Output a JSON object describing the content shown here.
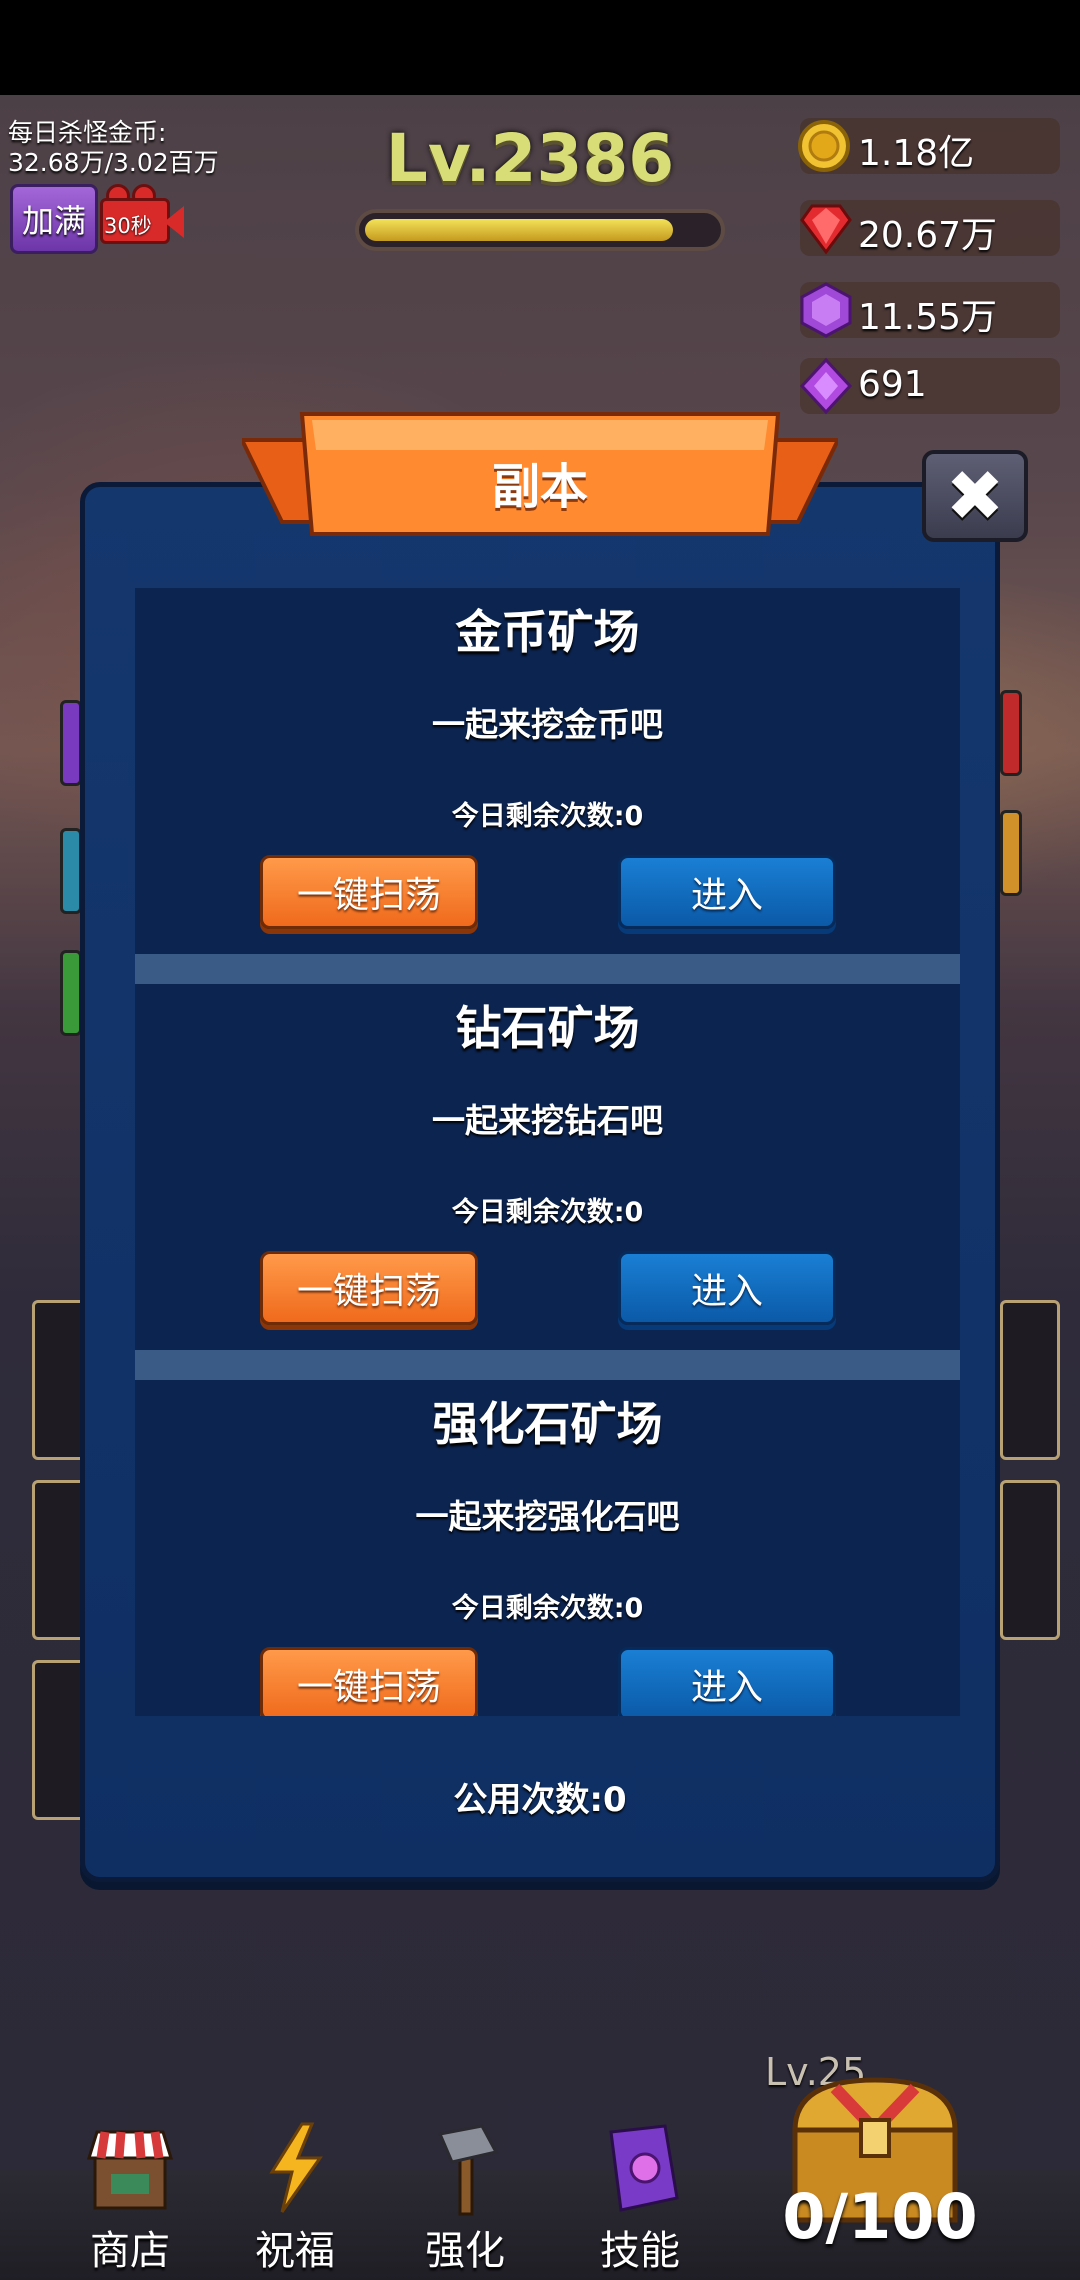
{
  "hud": {
    "kill_gold_label": "每日杀怪金币:",
    "kill_gold_value": "32.68万/3.02百万",
    "fill_button": "加满",
    "video_timer": "30秒",
    "level": "Lv.2386",
    "level_progress": 0.88
  },
  "resources": [
    {
      "name": "gold",
      "icon": "gold-coin-icon",
      "value": "1.18亿",
      "color": "#e8b820"
    },
    {
      "name": "ruby",
      "icon": "ruby-icon",
      "value": "20.67万",
      "color": "#e0282c"
    },
    {
      "name": "hex-gem",
      "icon": "purple-hex-gem-icon",
      "value": "11.55万",
      "color": "#a24ad8"
    },
    {
      "name": "diamond",
      "icon": "purple-diamond-icon",
      "value": "691",
      "color": "#b04ae0"
    }
  ],
  "dialog": {
    "title": "副本",
    "close_icon": "close-icon",
    "shared_count": "公用次数:0",
    "dungeons": [
      {
        "title": "金币矿场",
        "desc": "一起来挖金币吧",
        "remaining": "今日剩余次数:0",
        "sweep_label": "一键扫荡",
        "enter_label": "进入"
      },
      {
        "title": "钻石矿场",
        "desc": "一起来挖钻石吧",
        "remaining": "今日剩余次数:0",
        "sweep_label": "一键扫荡",
        "enter_label": "进入"
      },
      {
        "title": "强化石矿场",
        "desc": "一起来挖强化石吧",
        "remaining": "今日剩余次数:0",
        "sweep_label": "一键扫荡",
        "enter_label": "进入"
      }
    ]
  },
  "bottom_nav": [
    {
      "label": "商店",
      "icon": "shop-stall-icon"
    },
    {
      "label": "祝福",
      "icon": "lightning-icon"
    },
    {
      "label": "强化",
      "icon": "hammer-icon"
    },
    {
      "label": "技能",
      "icon": "spellbook-icon"
    }
  ],
  "chest": {
    "level": "Lv.25",
    "count": "0/100",
    "icon": "treasure-chest-icon"
  }
}
